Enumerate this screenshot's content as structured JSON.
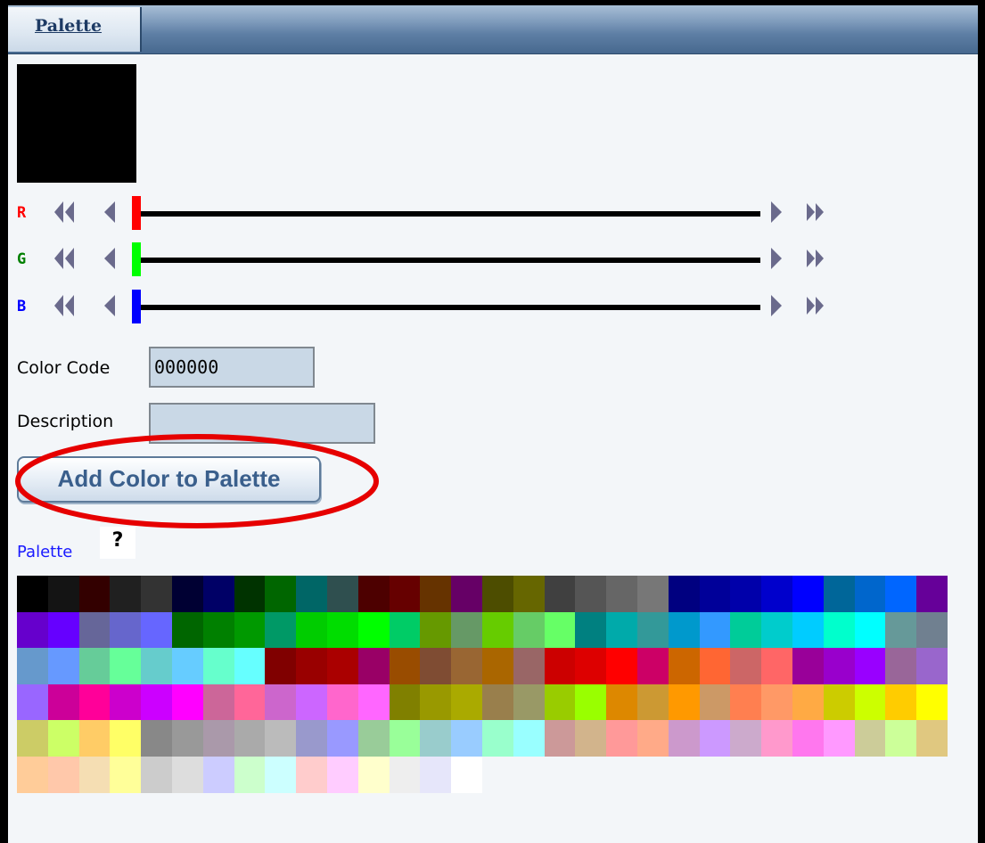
{
  "header": {
    "tab_label": "Palette"
  },
  "preview": {
    "color": "#000000"
  },
  "sliders": [
    {
      "channel": "R",
      "value": 0,
      "color": "#ff0000",
      "label_color": "#ff0000"
    },
    {
      "channel": "G",
      "value": 0,
      "color": "#00ff00",
      "label_color": "#008000"
    },
    {
      "channel": "B",
      "value": 0,
      "color": "#0000ff",
      "label_color": "#0000ff"
    }
  ],
  "form": {
    "color_code_label": "Color Code",
    "color_code_value": "000000",
    "description_label": "Description",
    "description_value": "",
    "add_button_label": "Add Color to Palette"
  },
  "palette": {
    "link_label": "Palette",
    "help_label": "?",
    "rows": [
      [
        "#000000",
        "#141414",
        "#330000",
        "#202020",
        "#333333",
        "#000033",
        "#000066",
        "#003300",
        "#006600",
        "#006666",
        "#2f4f4f",
        "#4d0000",
        "#660000",
        "#663300",
        "#660066",
        "#4d4d00",
        "#666600",
        "#404040",
        "#555555",
        "#666666",
        "#777777",
        "#000080",
        "#000099",
        "#0000aa",
        "#0000cc",
        "#0000ff",
        "#006699",
        "#0066cc",
        "#0066ff",
        "#660099"
      ],
      [
        "#6600cc",
        "#6600ff",
        "#666699",
        "#6666cc",
        "#6666ff",
        "#006600",
        "#008000",
        "#009900",
        "#009966",
        "#00cc00",
        "#00dd00",
        "#00ff00",
        "#00cc66",
        "#669900",
        "#669966",
        "#66cc00",
        "#66cc66",
        "#66ff66",
        "#008080",
        "#00aaaa",
        "#339999",
        "#0099cc",
        "#3399ff",
        "#00cc99",
        "#00cccc",
        "#00ccff",
        "#00ffcc",
        "#00ffff",
        "#669999",
        "#708090"
      ],
      [
        "#6699cc",
        "#6699ff",
        "#66cc99",
        "#66ff99",
        "#66cccc",
        "#66ccff",
        "#66ffcc",
        "#66ffff",
        "#800000",
        "#990000",
        "#aa0000",
        "#990066",
        "#994c00",
        "#7f4c33",
        "#996633",
        "#aa6600",
        "#996666",
        "#cc0000",
        "#dd0000",
        "#ff0000",
        "#cc0066",
        "#cc6600",
        "#ff6633",
        "#cc6666",
        "#ff6666",
        "#990099",
        "#9900cc",
        "#9900ff",
        "#996699",
        "#9966cc"
      ],
      [
        "#9966ff",
        "#cc0099",
        "#ff0099",
        "#cc00cc",
        "#cc00ff",
        "#ff00ff",
        "#cc6699",
        "#ff6699",
        "#cc66cc",
        "#cc66ff",
        "#ff66cc",
        "#ff66ff",
        "#808000",
        "#999900",
        "#aaaa00",
        "#997f4c",
        "#999966",
        "#99cc00",
        "#99ff00",
        "#dd8800",
        "#cc9933",
        "#ff9900",
        "#cc9966",
        "#ff7f50",
        "#ff9966",
        "#ffaa44",
        "#cccc00",
        "#ccff00",
        "#ffcc00",
        "#ffff00"
      ],
      [
        "#cccc66",
        "#ccff66",
        "#ffcc66",
        "#ffff66",
        "#888888",
        "#999999",
        "#aa99aa",
        "#aaaaaa",
        "#bbbbbb",
        "#9999cc",
        "#9999ff",
        "#99cc99",
        "#99ff99",
        "#99cccc",
        "#99ccff",
        "#99ffcc",
        "#99ffff",
        "#cc9999",
        "#d2b48c",
        "#ff9999",
        "#ffaa88",
        "#cc99cc",
        "#cc99ff",
        "#ccaacc",
        "#ff99cc",
        "#ff77ee",
        "#ff99ff",
        "#cccc99",
        "#ccff99",
        "#e0c880"
      ],
      [
        "#ffcc99",
        "#ffc8aa",
        "#f5deb3",
        "#ffff99",
        "#cccccc",
        "#dddddd",
        "#ccccff",
        "#ccffcc",
        "#ccffff",
        "#ffcccc",
        "#ffccff",
        "#ffffcc",
        "#eeeeee",
        "#e6e6fa",
        "#ffffff"
      ]
    ]
  }
}
